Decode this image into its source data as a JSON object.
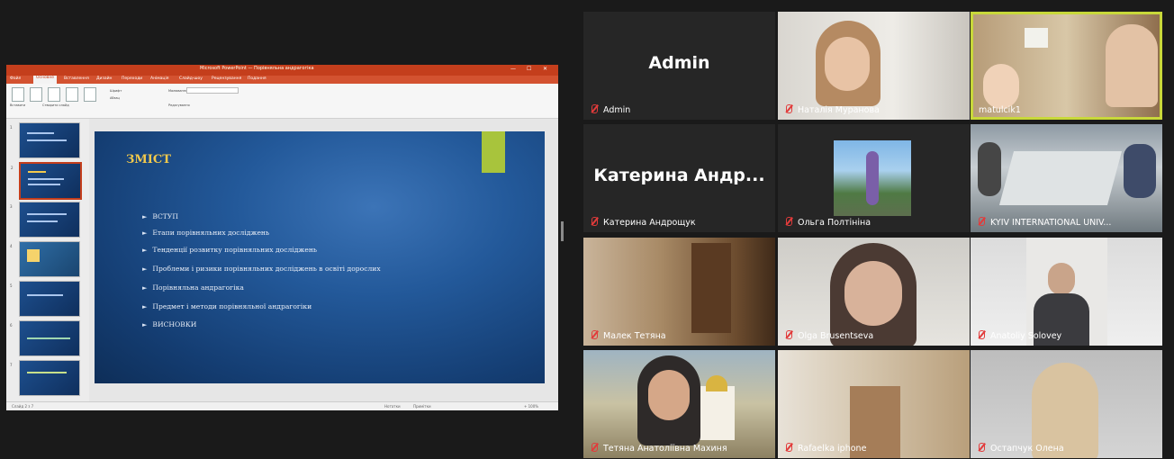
{
  "ppt": {
    "title": "Microsoft PowerPoint — Порівняльна андрагогіка",
    "window_controls": [
      "—",
      "☐",
      "✕"
    ],
    "tabs": [
      "Файл",
      "Основне",
      "Вставлення",
      "Дизайн",
      "Переходи",
      "Анімація",
      "Слайд-шоу",
      "Рецензування",
      "Подання"
    ],
    "active_tab": "Основне",
    "ribbon_labels": [
      "Вставити",
      "Створити слайд",
      "Шрифт",
      "Абзац",
      "Малювання",
      "Редагування"
    ],
    "slide_numbers": [
      "1",
      "2",
      "3",
      "4",
      "5",
      "6",
      "7"
    ],
    "slide": {
      "title": "ЗМІСТ",
      "bullets": [
        "ВСТУП",
        "Етапи порівняльних досліджень",
        "Тенденції розвитку порівняльних досліджень",
        "Проблеми і ризики порівняльних досліджень в освіті дорослих",
        "Порівняльна андрагогіка",
        "Предмет і методи порівняльної андрагогіки",
        "ВИСНОВКИ"
      ]
    },
    "status": [
      "Слайд 2 з 7",
      "Нотатки",
      "Примітки",
      "+ 100%"
    ]
  },
  "participants": [
    {
      "name": "Admin",
      "display": "Admin"
    },
    {
      "name": "Наталія Муранова"
    },
    {
      "name": "matulcik1"
    },
    {
      "name": "Катерина Андрощук",
      "display": "Катерина Андр..."
    },
    {
      "name": "Ольга Полтініна"
    },
    {
      "name": "KYIV INTERNATIONAL UNIV..."
    },
    {
      "name": "Малек Тетяна"
    },
    {
      "name": "Olga Brusentseva"
    },
    {
      "name": "Anatoliy Solovey"
    },
    {
      "name": "Тетяна Анатоліївна Махиня"
    },
    {
      "name": "Rafaelka iphone"
    },
    {
      "name": "Остапчук Олена"
    }
  ],
  "colors": {
    "active_speaker": "#c8d83a",
    "mic_muted": "#e23b3b",
    "ppt_brand": "#c43e1c",
    "slide_title": "#f2c94c"
  }
}
